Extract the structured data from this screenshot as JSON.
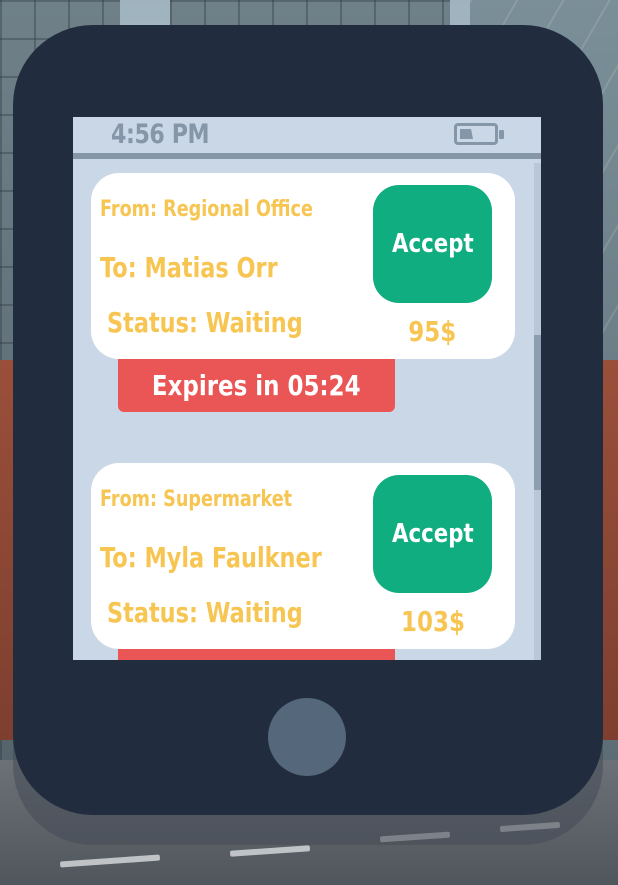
{
  "phone": {
    "clock": "4:56 PM",
    "battery_level": 0.4
  },
  "deliveries": [
    {
      "from": "From: Regional Office",
      "to": "To: Matias Orr",
      "status": "Status: Waiting",
      "accept_label": "Accept",
      "price": "95$",
      "expires": "Expires in 05:24"
    },
    {
      "from": "From: Supermarket",
      "to": "To: Myla Faulkner",
      "status": "Status: Waiting",
      "accept_label": "Accept",
      "price": "103$",
      "expires": ""
    }
  ],
  "colors": {
    "phone_body": "#212d3e",
    "screen_bg": "#cad7e6",
    "text_accent": "#f7c552",
    "accept_green": "#10ad80",
    "expire_red": "#ea5555"
  }
}
